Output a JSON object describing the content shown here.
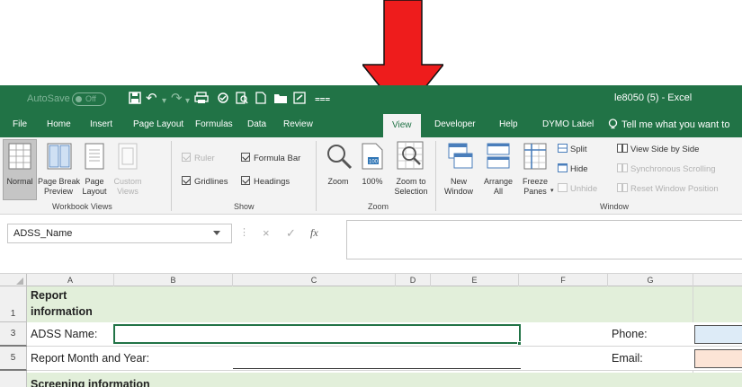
{
  "titlebar": {
    "autosave_label": "AutoSave",
    "autosave_state": "Off",
    "file_title": "le8050 (5)  -  Excel"
  },
  "tabs": [
    "File",
    "Home",
    "Insert",
    "Page Layout",
    "Formulas",
    "Data",
    "Review",
    "View",
    "Developer",
    "Help",
    "DYMO Label"
  ],
  "active_tab": "View",
  "tell_me": "Tell me what you want to",
  "ribbon": {
    "workbook_views": {
      "label": "Workbook Views",
      "normal": "Normal",
      "page_break": [
        "Page Break",
        "Preview"
      ],
      "page_layout": [
        "Page",
        "Layout"
      ],
      "custom_views": [
        "Custom",
        "Views"
      ]
    },
    "show": {
      "label": "Show",
      "ruler": "Ruler",
      "formula_bar": "Formula Bar",
      "gridlines": "Gridlines",
      "headings": "Headings"
    },
    "zoom": {
      "label": "Zoom",
      "zoom": "Zoom",
      "hundred": "100%",
      "zoom_selection": [
        "Zoom to",
        "Selection"
      ]
    },
    "window": {
      "label": "Window",
      "new_window": [
        "New",
        "Window"
      ],
      "arrange_all": [
        "Arrange",
        "All"
      ],
      "freeze_panes": [
        "Freeze",
        "Panes"
      ],
      "split": "Split",
      "hide": "Hide",
      "unhide": "Unhide",
      "view_side": "View Side by Side",
      "sync_scroll": "Synchronous Scrolling",
      "reset_pos": "Reset Window Position"
    }
  },
  "formula_bar": {
    "name_box": "ADSS_Name",
    "fx": "fx",
    "cancel": "×",
    "enter": "✓"
  },
  "sheet": {
    "columns": [
      "A",
      "B",
      "C",
      "D",
      "E",
      "F",
      "G"
    ],
    "rows": [
      "1",
      "3",
      "5"
    ],
    "report_info": [
      "Report",
      "information"
    ],
    "adss_name": "ADSS Name:",
    "phone": "Phone:",
    "report_month": "Report Month and Year:",
    "email": "Email:",
    "next_section": "Screening information"
  },
  "colors": {
    "excel_green": "#217346",
    "arrow_red": "#ee1c1c",
    "section_fill": "#e2efda",
    "phone_fill": "#ddebf7",
    "email_fill": "#fce4d6"
  }
}
